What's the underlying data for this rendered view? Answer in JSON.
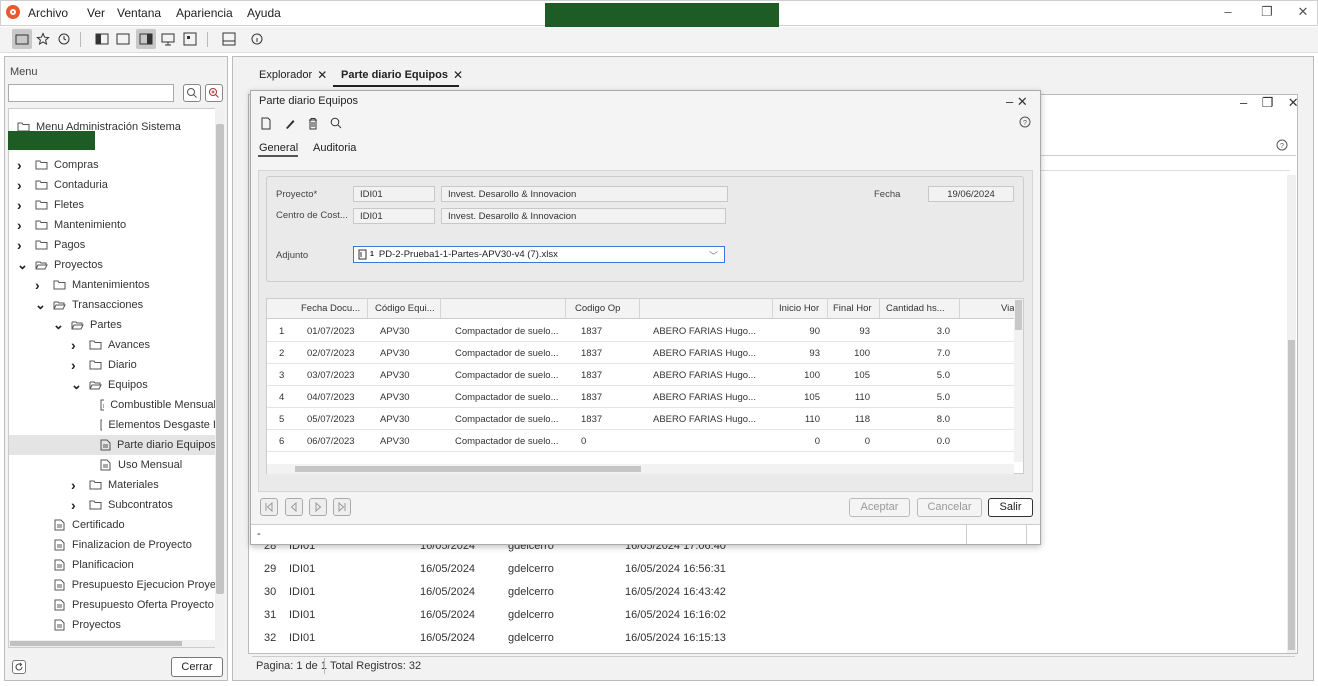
{
  "menubar": {
    "items": [
      "Archivo",
      "Ver",
      "Ventana",
      "Apariencia",
      "Ayuda"
    ],
    "window_controls": [
      "–",
      "❐",
      "✕"
    ]
  },
  "left": {
    "title": "Menu",
    "tree": [
      {
        "label": "Menu Administración Sistema",
        "level": 0,
        "arrow": "",
        "icon": "folder"
      },
      {
        "label": "Compras",
        "level": 0,
        "arrow": "right",
        "icon": "folder"
      },
      {
        "label": "Contaduria",
        "level": 0,
        "arrow": "right",
        "icon": "folder"
      },
      {
        "label": "Fletes",
        "level": 0,
        "arrow": "right",
        "icon": "folder"
      },
      {
        "label": "Mantenimiento",
        "level": 0,
        "arrow": "right",
        "icon": "folder"
      },
      {
        "label": "Pagos",
        "level": 0,
        "arrow": "right",
        "icon": "folder"
      },
      {
        "label": "Proyectos",
        "level": 0,
        "arrow": "down",
        "icon": "folder-open"
      },
      {
        "label": "Mantenimientos",
        "level": 1,
        "arrow": "right",
        "icon": "folder"
      },
      {
        "label": "Transacciones",
        "level": 1,
        "arrow": "down",
        "icon": "folder-open"
      },
      {
        "label": "Partes",
        "level": 2,
        "arrow": "down",
        "icon": "folder-open"
      },
      {
        "label": "Avances",
        "level": 3,
        "arrow": "right",
        "icon": "folder"
      },
      {
        "label": "Diario",
        "level": 3,
        "arrow": "right",
        "icon": "folder"
      },
      {
        "label": "Equipos",
        "level": 3,
        "arrow": "down",
        "icon": "folder-open"
      },
      {
        "label": "Combustible Mensual",
        "level": 4,
        "arrow": "",
        "icon": "doc"
      },
      {
        "label": "Elementos Desgaste I",
        "level": 4,
        "arrow": "",
        "icon": "doc"
      },
      {
        "label": "Parte diario Equipos",
        "level": 4,
        "arrow": "",
        "icon": "doc",
        "selected": true
      },
      {
        "label": "Uso Mensual",
        "level": 4,
        "arrow": "",
        "icon": "doc"
      },
      {
        "label": "Materiales",
        "level": 3,
        "arrow": "right",
        "icon": "folder"
      },
      {
        "label": "Subcontratos",
        "level": 3,
        "arrow": "right",
        "icon": "folder"
      },
      {
        "label": "Certificado",
        "level": 2,
        "arrow": "",
        "icon": "doc"
      },
      {
        "label": "Finalizacion de Proyecto",
        "level": 2,
        "arrow": "",
        "icon": "doc"
      },
      {
        "label": "Planificacion",
        "level": 2,
        "arrow": "",
        "icon": "doc"
      },
      {
        "label": "Presupuesto Ejecucion Proye",
        "level": 2,
        "arrow": "",
        "icon": "doc"
      },
      {
        "label": "Presupuesto Oferta Proyecto",
        "level": 2,
        "arrow": "",
        "icon": "doc"
      },
      {
        "label": "Proyectos",
        "level": 2,
        "arrow": "",
        "icon": "doc"
      }
    ],
    "close_button": "Cerrar"
  },
  "tabs": {
    "explorer": "Explorador",
    "active": "Parte diario Equipos"
  },
  "background_list": {
    "rows": [
      {
        "n": "28",
        "proj": "IDI01",
        "date": "16/05/2024",
        "user": "gdelcerro",
        "ts": "16/05/2024 17:06:40"
      },
      {
        "n": "29",
        "proj": "IDI01",
        "date": "16/05/2024",
        "user": "gdelcerro",
        "ts": "16/05/2024 16:56:31"
      },
      {
        "n": "30",
        "proj": "IDI01",
        "date": "16/05/2024",
        "user": "gdelcerro",
        "ts": "16/05/2024 16:43:42"
      },
      {
        "n": "31",
        "proj": "IDI01",
        "date": "16/05/2024",
        "user": "gdelcerro",
        "ts": "16/05/2024 16:16:02"
      },
      {
        "n": "32",
        "proj": "IDI01",
        "date": "16/05/2024",
        "user": "gdelcerro",
        "ts": "16/05/2024 16:15:13"
      }
    ],
    "status_page": "Pagina: 1 de 1",
    "status_total": "Total Registros: 32"
  },
  "dialog": {
    "title": "Parte diario Equipos",
    "controls": "–  ✕",
    "tabs": [
      "General",
      "Auditoria"
    ],
    "form": {
      "proyecto_label": "Proyecto*",
      "proyecto_code": "IDI01",
      "proyecto_desc": "Invest. Desarollo & Innovacion",
      "fecha_label": "Fecha",
      "fecha_value": "19/06/2024",
      "centro_label": "Centro de Cost...",
      "centro_code": "IDI01",
      "centro_desc": "Invest. Desarollo & Innovacion",
      "adjunto_label": "Adjunto",
      "adjunto_count": "1",
      "adjunto_value": "PD-2-Prueba1-1-Partes-APV30-v4 (7).xlsx"
    },
    "grid": {
      "headers": [
        "Fecha Docu...",
        "Código Equi...",
        "Codigo Op",
        "Inicio Hor",
        "Final Hor",
        "Cantidad hs...",
        "Via"
      ],
      "rows": [
        {
          "n": "1",
          "fecha": "01/07/2023",
          "cod": "APV30",
          "desc": "Compactador de suelo...",
          "op": "1837",
          "nombre": "ABERO FARIAS Hugo...",
          "ini": "90",
          "fin": "93",
          "cant": "3.0"
        },
        {
          "n": "2",
          "fecha": "02/07/2023",
          "cod": "APV30",
          "desc": "Compactador de suelo...",
          "op": "1837",
          "nombre": "ABERO FARIAS Hugo...",
          "ini": "93",
          "fin": "100",
          "cant": "7.0"
        },
        {
          "n": "3",
          "fecha": "03/07/2023",
          "cod": "APV30",
          "desc": "Compactador de suelo...",
          "op": "1837",
          "nombre": "ABERO FARIAS Hugo...",
          "ini": "100",
          "fin": "105",
          "cant": "5.0"
        },
        {
          "n": "4",
          "fecha": "04/07/2023",
          "cod": "APV30",
          "desc": "Compactador de suelo...",
          "op": "1837",
          "nombre": "ABERO FARIAS Hugo...",
          "ini": "105",
          "fin": "110",
          "cant": "5.0"
        },
        {
          "n": "5",
          "fecha": "05/07/2023",
          "cod": "APV30",
          "desc": "Compactador de suelo...",
          "op": "1837",
          "nombre": "ABERO FARIAS Hugo...",
          "ini": "110",
          "fin": "118",
          "cant": "8.0"
        },
        {
          "n": "6",
          "fecha": "06/07/2023",
          "cod": "APV30",
          "desc": "Compactador de suelo...",
          "op": "0",
          "nombre": "",
          "ini": "0",
          "fin": "0",
          "cant": "0.0"
        }
      ]
    },
    "buttons": {
      "aceptar": "Aceptar",
      "cancelar": "Cancelar",
      "salir": "Salir"
    },
    "status": "-"
  },
  "colors": {
    "accent": "#3b78d8",
    "brand_green": "#1d5c25",
    "logo_orange": "#e8592b"
  }
}
